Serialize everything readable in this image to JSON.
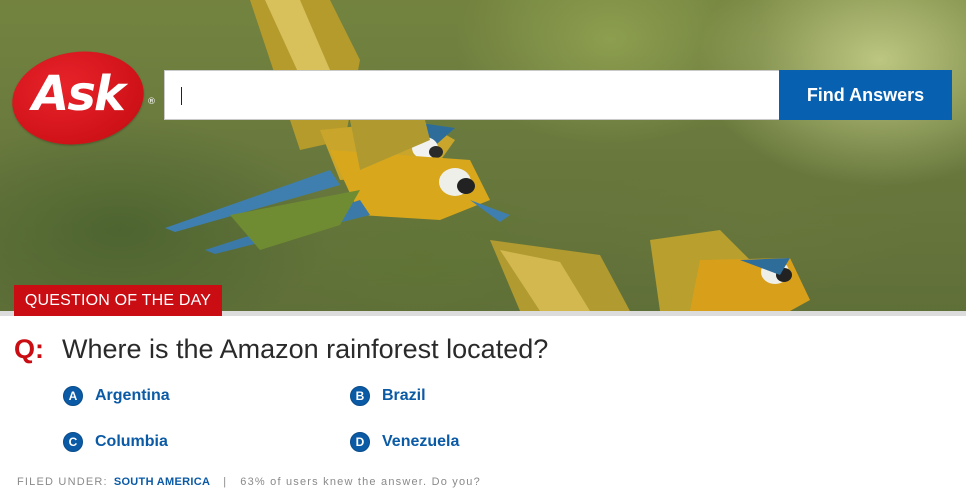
{
  "logo": {
    "text": "Ask",
    "registered_mark": "®",
    "color": "#cf1218"
  },
  "search": {
    "value": "",
    "placeholder": "",
    "button_label": "Find Answers",
    "button_color": "#0861b0"
  },
  "qotd": {
    "banner_label": "QUESTION OF THE DAY",
    "banner_color": "#c90d13",
    "question_prefix": "Q:",
    "question_text": "Where is the Amazon rainforest located?",
    "answers": [
      {
        "letter": "A",
        "label": "Argentina"
      },
      {
        "letter": "B",
        "label": "Brazil"
      },
      {
        "letter": "C",
        "label": "Columbia"
      },
      {
        "letter": "D",
        "label": "Venezuela"
      }
    ],
    "answer_color": "#0a5aa6"
  },
  "footer": {
    "filed_label": "FILED UNDER:",
    "filed_link": "SOUTH AMERICA",
    "separator": "|",
    "stat_text": "63% of users knew the answer. Do you?"
  }
}
